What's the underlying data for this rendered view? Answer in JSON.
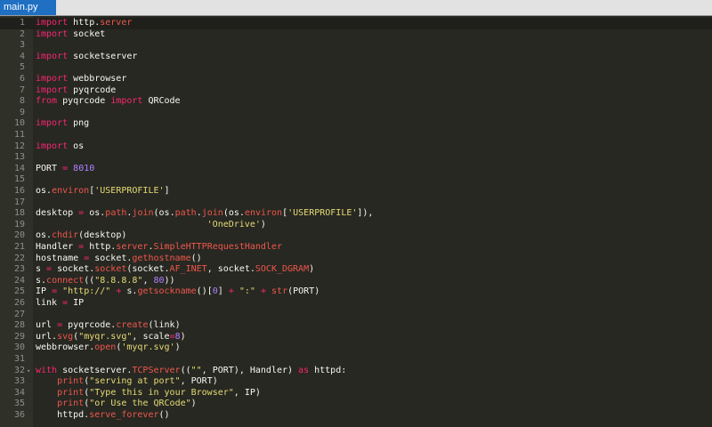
{
  "tab": {
    "label": "main.py"
  },
  "theme": {
    "background": "#272822",
    "gutter": "#2f3129",
    "keyword": "#f92672",
    "function": "#f0564c",
    "number": "#ae81ff",
    "string": "#e6db74",
    "text": "#f8f8f2",
    "tab_active": "#1f6fc2"
  },
  "fold_marker": "▾",
  "active_line": 1,
  "lines": [
    {
      "n": "1",
      "t": [
        [
          "import",
          "kw"
        ],
        [
          " http.",
          "plain"
        ],
        [
          "server",
          "fn"
        ]
      ]
    },
    {
      "n": "2",
      "t": [
        [
          "import",
          "kw"
        ],
        [
          " socket",
          "plain"
        ]
      ]
    },
    {
      "n": "3",
      "t": []
    },
    {
      "n": "4",
      "t": [
        [
          "import",
          "kw"
        ],
        [
          " socketserver",
          "plain"
        ]
      ]
    },
    {
      "n": "5",
      "t": []
    },
    {
      "n": "6",
      "t": [
        [
          "import",
          "kw"
        ],
        [
          " webbrowser",
          "plain"
        ]
      ]
    },
    {
      "n": "7",
      "t": [
        [
          "import",
          "kw"
        ],
        [
          " pyqrcode",
          "plain"
        ]
      ]
    },
    {
      "n": "8",
      "t": [
        [
          "from",
          "kw"
        ],
        [
          " pyqrcode ",
          "plain"
        ],
        [
          "import",
          "kw"
        ],
        [
          " QRCode",
          "plain"
        ]
      ]
    },
    {
      "n": "9",
      "t": []
    },
    {
      "n": "10",
      "t": [
        [
          "import",
          "kw"
        ],
        [
          " png",
          "plain"
        ]
      ]
    },
    {
      "n": "11",
      "t": []
    },
    {
      "n": "12",
      "t": [
        [
          "import",
          "kw"
        ],
        [
          " os",
          "plain"
        ]
      ]
    },
    {
      "n": "13",
      "t": []
    },
    {
      "n": "14",
      "t": [
        [
          "PORT ",
          "plain"
        ],
        [
          "=",
          "kw"
        ],
        [
          " ",
          "plain"
        ],
        [
          "8010",
          "num"
        ]
      ]
    },
    {
      "n": "15",
      "t": []
    },
    {
      "n": "16",
      "t": [
        [
          "os.",
          "plain"
        ],
        [
          "environ",
          "fn"
        ],
        [
          "[",
          "plain"
        ],
        [
          "'USERPROFILE'",
          "str"
        ],
        [
          "]",
          "plain"
        ]
      ]
    },
    {
      "n": "17",
      "t": []
    },
    {
      "n": "18",
      "t": [
        [
          "desktop ",
          "plain"
        ],
        [
          "=",
          "kw"
        ],
        [
          " os.",
          "plain"
        ],
        [
          "path",
          "fn"
        ],
        [
          ".",
          "plain"
        ],
        [
          "join",
          "fn"
        ],
        [
          "(os.",
          "plain"
        ],
        [
          "path",
          "fn"
        ],
        [
          ".",
          "plain"
        ],
        [
          "join",
          "fn"
        ],
        [
          "(os.",
          "plain"
        ],
        [
          "environ",
          "fn"
        ],
        [
          "[",
          "plain"
        ],
        [
          "'USERPROFILE'",
          "str"
        ],
        [
          "]),",
          "plain"
        ]
      ]
    },
    {
      "n": "19",
      "t": [
        [
          "                                ",
          "plain"
        ],
        [
          "'OneDrive'",
          "str"
        ],
        [
          ")",
          "plain"
        ]
      ]
    },
    {
      "n": "20",
      "t": [
        [
          "os.",
          "plain"
        ],
        [
          "chdir",
          "fn"
        ],
        [
          "(desktop)",
          "plain"
        ]
      ]
    },
    {
      "n": "21",
      "t": [
        [
          "Handler ",
          "plain"
        ],
        [
          "=",
          "kw"
        ],
        [
          " http.",
          "plain"
        ],
        [
          "server",
          "fn"
        ],
        [
          ".",
          "plain"
        ],
        [
          "SimpleHTTPRequestHandler",
          "fn"
        ]
      ]
    },
    {
      "n": "22",
      "t": [
        [
          "hostname ",
          "plain"
        ],
        [
          "=",
          "kw"
        ],
        [
          " socket.",
          "plain"
        ],
        [
          "gethostname",
          "fn"
        ],
        [
          "()",
          "plain"
        ]
      ]
    },
    {
      "n": "23",
      "t": [
        [
          "s ",
          "plain"
        ],
        [
          "=",
          "kw"
        ],
        [
          " socket.",
          "plain"
        ],
        [
          "socket",
          "fn"
        ],
        [
          "(socket.",
          "plain"
        ],
        [
          "AF_INET",
          "fn"
        ],
        [
          ", socket.",
          "plain"
        ],
        [
          "SOCK_DGRAM",
          "fn"
        ],
        [
          ")",
          "plain"
        ]
      ]
    },
    {
      "n": "24",
      "t": [
        [
          "s.",
          "plain"
        ],
        [
          "connect",
          "fn"
        ],
        [
          "((",
          "plain"
        ],
        [
          "\"8.8.8.8\"",
          "str"
        ],
        [
          ", ",
          "plain"
        ],
        [
          "80",
          "num"
        ],
        [
          "))",
          "plain"
        ]
      ]
    },
    {
      "n": "25",
      "t": [
        [
          "IP ",
          "plain"
        ],
        [
          "=",
          "kw"
        ],
        [
          " ",
          "plain"
        ],
        [
          "\"http://\"",
          "str"
        ],
        [
          " ",
          "plain"
        ],
        [
          "+",
          "kw"
        ],
        [
          " s.",
          "plain"
        ],
        [
          "getsockname",
          "fn"
        ],
        [
          "()[",
          "plain"
        ],
        [
          "0",
          "num"
        ],
        [
          "] ",
          "plain"
        ],
        [
          "+",
          "kw"
        ],
        [
          " ",
          "plain"
        ],
        [
          "\":\"",
          "str"
        ],
        [
          " ",
          "plain"
        ],
        [
          "+",
          "kw"
        ],
        [
          " ",
          "plain"
        ],
        [
          "str",
          "fn"
        ],
        [
          "(PORT)",
          "plain"
        ]
      ]
    },
    {
      "n": "26",
      "t": [
        [
          "link ",
          "plain"
        ],
        [
          "=",
          "kw"
        ],
        [
          " IP",
          "plain"
        ]
      ]
    },
    {
      "n": "27",
      "t": []
    },
    {
      "n": "28",
      "t": [
        [
          "url ",
          "plain"
        ],
        [
          "=",
          "kw"
        ],
        [
          " pyqrcode.",
          "plain"
        ],
        [
          "create",
          "fn"
        ],
        [
          "(link)",
          "plain"
        ]
      ]
    },
    {
      "n": "29",
      "t": [
        [
          "url.",
          "plain"
        ],
        [
          "svg",
          "fn"
        ],
        [
          "(",
          "plain"
        ],
        [
          "\"myqr.svg\"",
          "str"
        ],
        [
          ", scale",
          "plain"
        ],
        [
          "=",
          "kw"
        ],
        [
          "8",
          "num"
        ],
        [
          ")",
          "plain"
        ]
      ]
    },
    {
      "n": "30",
      "t": [
        [
          "webbrowser.",
          "plain"
        ],
        [
          "open",
          "fn"
        ],
        [
          "(",
          "plain"
        ],
        [
          "'myqr.svg'",
          "str"
        ],
        [
          ")",
          "plain"
        ]
      ]
    },
    {
      "n": "31",
      "t": []
    },
    {
      "n": "32",
      "fold": true,
      "t": [
        [
          "with",
          "kw"
        ],
        [
          " socketserver.",
          "plain"
        ],
        [
          "TCPServer",
          "fn"
        ],
        [
          "((",
          "plain"
        ],
        [
          "\"\"",
          "str"
        ],
        [
          ", PORT), Handler) ",
          "plain"
        ],
        [
          "as",
          "kw"
        ],
        [
          " httpd:",
          "plain"
        ]
      ]
    },
    {
      "n": "33",
      "t": [
        [
          "    ",
          "plain"
        ],
        [
          "print",
          "fn"
        ],
        [
          "(",
          "plain"
        ],
        [
          "\"serving at port\"",
          "str"
        ],
        [
          ", PORT)",
          "plain"
        ]
      ]
    },
    {
      "n": "34",
      "t": [
        [
          "    ",
          "plain"
        ],
        [
          "print",
          "fn"
        ],
        [
          "(",
          "plain"
        ],
        [
          "\"Type this in your Browser\"",
          "str"
        ],
        [
          ", IP)",
          "plain"
        ]
      ]
    },
    {
      "n": "35",
      "t": [
        [
          "    ",
          "plain"
        ],
        [
          "print",
          "fn"
        ],
        [
          "(",
          "plain"
        ],
        [
          "\"or Use the QRCode\"",
          "str"
        ],
        [
          ")",
          "plain"
        ]
      ]
    },
    {
      "n": "36",
      "t": [
        [
          "    httpd.",
          "plain"
        ],
        [
          "serve_forever",
          "fn"
        ],
        [
          "()",
          "plain"
        ]
      ]
    }
  ]
}
